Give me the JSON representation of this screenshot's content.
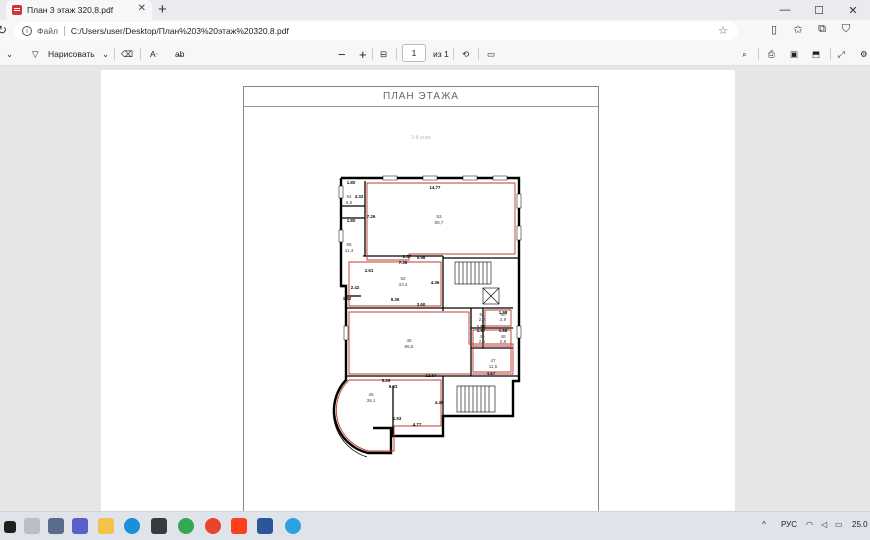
{
  "browser": {
    "tab_title": "План 3 этаж 320,8.pdf",
    "tab_close": "✕",
    "new_tab": "+",
    "url_scheme": "Файл",
    "url_path": "C:/Users/user/Desktop/План%203%20этаж%20320.8.pdf",
    "win_minimize": "—",
    "win_maximize": "☐",
    "win_close": "✕"
  },
  "pdf_toolbar": {
    "draw_label": "Нарисовать",
    "page_current": "1",
    "page_total": "из 1"
  },
  "document": {
    "sheet_title": "ПЛАН ЭТАЖА",
    "sheet_subtitle": "3-й этаж",
    "rooms": [
      {
        "id": "r53",
        "num": "53",
        "area": "86,7"
      },
      {
        "id": "r52",
        "num": "52",
        "area": "33,4"
      },
      {
        "id": "r46",
        "num": "46",
        "area": "85,5"
      },
      {
        "id": "r45",
        "num": "45",
        "area": "38,1"
      },
      {
        "id": "r47",
        "num": "47",
        "area": "11,5"
      },
      {
        "id": "r54",
        "num": "54",
        "area": "6,5"
      },
      {
        "id": "r55",
        "num": "55",
        "area": "11,4"
      },
      {
        "id": "r51",
        "num": "51",
        "area": "2,9"
      },
      {
        "id": "r50",
        "num": "50",
        "area": "2,9"
      },
      {
        "id": "r49",
        "num": "49",
        "area": "2,9"
      },
      {
        "id": "r48",
        "num": "48",
        "area": "2,9"
      }
    ],
    "dims": {
      "d1": "14.77",
      "d2": "1.80",
      "d3": "1.80",
      "d4": "3.32",
      "d5": "7.26",
      "d6": "7.36",
      "d7": "0.98",
      "d8": "2.57",
      "d9": "2.61",
      "d10": "4.36",
      "d11": "2.42",
      "d12": "1.52",
      "d13": "9.35",
      "d14": "3.60",
      "d15": "1.98",
      "d16": "1.58",
      "d17": "1.97",
      "d18": "1.98",
      "d19": "5.26",
      "d20": "9.83",
      "d21": "12.57",
      "d22": "4.67",
      "d23": "4.77",
      "d24": "4.48",
      "d25": "1.53"
    }
  },
  "taskbar": {
    "lang": "РУС",
    "time": "25.0"
  }
}
